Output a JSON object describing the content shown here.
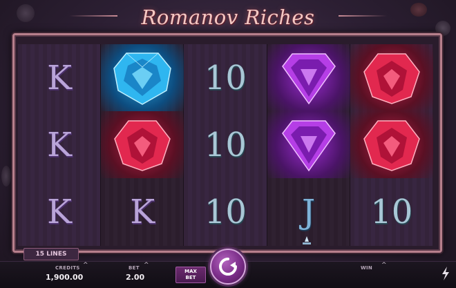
{
  "game": {
    "title": "Romanov Riches",
    "lines_label": "15 LINES"
  },
  "reels": [
    [
      "K",
      "K",
      "K"
    ],
    [
      "blue-sapphire",
      "red-ruby",
      "K"
    ],
    [
      "10",
      "10",
      "10"
    ],
    [
      "purple-amethyst",
      "purple-amethyst",
      "J"
    ],
    [
      "red-ruby",
      "red-ruby",
      "10"
    ]
  ],
  "controls": {
    "credits_label": "CREDITS",
    "credits_value": "1,900.00",
    "bet_label": "BET",
    "bet_value": "2.00",
    "maxbet_label_1": "MAX",
    "maxbet_label_2": "BET",
    "win_label": "WIN",
    "up_caret": "^"
  },
  "colors": {
    "title": "#f3c9c4",
    "frame": "#b77f8c",
    "spin_button": "#7a2d88",
    "letter_symbol": "#b9a4d8",
    "ten_symbol": "#a9c7d6"
  }
}
